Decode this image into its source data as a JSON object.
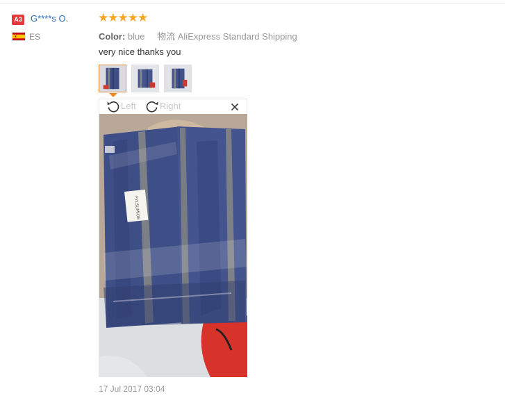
{
  "reviewer": {
    "level_badge": "A3",
    "name": "G****s O.",
    "country_code": "ES",
    "flag_icon": "spain-flag-icon"
  },
  "review": {
    "rating": 5,
    "stars_text": "★★★★★",
    "color_label": "Color:",
    "color_value": "blue",
    "shipping_label": "物流",
    "shipping_value": "AliExpress Standard Shipping",
    "comment": "very nice thanks you",
    "date": "17 Jul 2017 03:04",
    "thumbnail_count": 3,
    "active_thumbnail": 1
  },
  "viewer": {
    "rotate_left_label": "Left",
    "rotate_right_label": "Right",
    "rotate_left_icon": "rotate-left-icon",
    "rotate_right_icon": "rotate-right-icon",
    "close_icon": "close-icon",
    "product_tag_text": "FYLSUMIOE"
  },
  "colors": {
    "badge": "#e4393c",
    "star": "#f5a623",
    "username": "#2a6ebb",
    "active_thumb_border": "#e08a3c",
    "fabric": "#3e4e86"
  }
}
